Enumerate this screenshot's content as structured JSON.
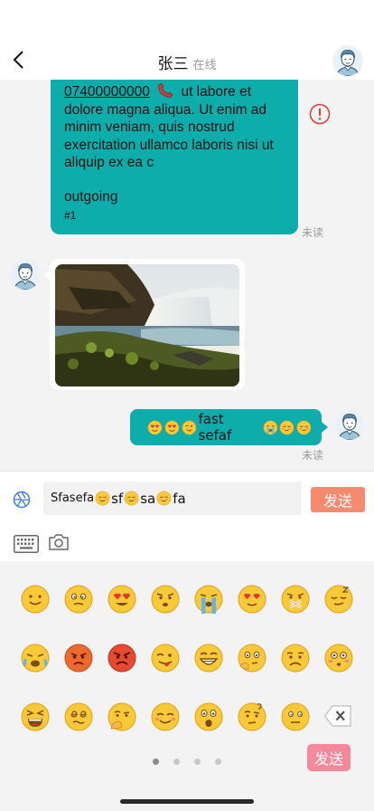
{
  "header": {
    "title": "张三",
    "subtitle": "在线",
    "avatar_icon": "user-avatar"
  },
  "messages": [
    {
      "type": "text",
      "direction": "outgoing",
      "phone": "07400000000",
      "phone_icon": "telephone-receiver",
      "text": "ut labore et dolore magna aliqua. Ut enim ad minim veniam, quis nostrud exercitation ullamco laboris nisi ut aliquip ex ea c",
      "footer_line1": "outgoing",
      "footer_line2": "#1",
      "status_icon": "error-exclamation",
      "read_status": "未读"
    },
    {
      "type": "image",
      "direction": "incoming",
      "image_desc": "waterfall"
    },
    {
      "type": "text",
      "direction": "outgoing",
      "prefix_emojis": [
        "heart-eyes",
        "heart-eyes",
        "wink-tongue"
      ],
      "text": "fast sefaf",
      "suffix_emojis": [
        "crying",
        "smirk",
        "smirk"
      ],
      "read_status": "未读"
    }
  ],
  "input": {
    "segments": [
      "Sfasefa",
      "sf",
      "sa",
      "fa"
    ],
    "send_label": "发送"
  },
  "toolbar": {
    "keyboard_icon": "keyboard",
    "camera_icon": "camera"
  },
  "emoji_panel": {
    "rows": [
      [
        "smile",
        "confused",
        "heart-eyes",
        "annoyed",
        "crying",
        "heart-eyes-wink",
        "zipped",
        "sleepy"
      ],
      [
        "loud-crying",
        "angry",
        "furious",
        "wink-tongue",
        "grin",
        "thinking",
        "sad",
        "flushed"
      ],
      [
        "scream",
        "dizzy",
        "hmm",
        "blush",
        "surprised",
        "question",
        "neutral",
        "backspace"
      ]
    ],
    "page_count": 4,
    "active_page": 1,
    "send_label": "发送"
  },
  "colors": {
    "bubble_out": "#0cadab",
    "send_top": "#f58a6e",
    "send_bottom": "#f6889c",
    "error": "#e53935",
    "aperture": "#3a7ee8"
  }
}
